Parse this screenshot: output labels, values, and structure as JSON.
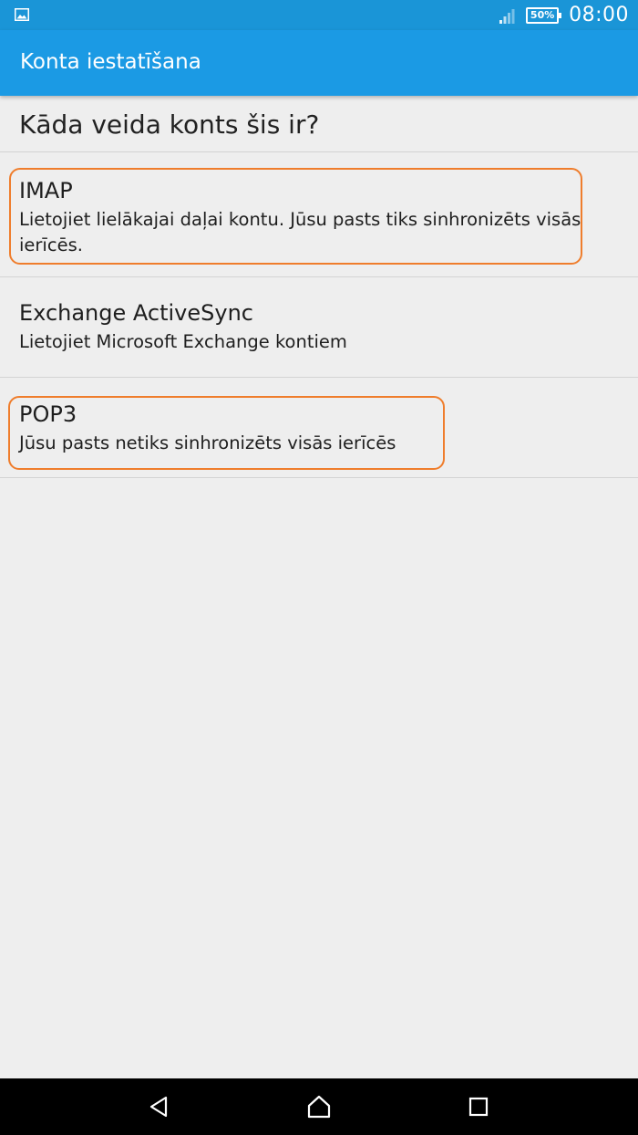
{
  "status_bar": {
    "battery": "50%",
    "time": "08:00",
    "icons": [
      "image-notification-icon",
      "signal-icon",
      "battery-icon"
    ]
  },
  "app_bar": {
    "title": "Konta iestatīšana"
  },
  "question": "Kāda veida konts šis ir?",
  "options": [
    {
      "title": "IMAP",
      "description": "Lietojiet lielākajai daļai kontu. Jūsu pasts tiks sinhronizēts visās ierīcēs."
    },
    {
      "title": "Exchange ActiveSync",
      "description": "Lietojiet Microsoft Exchange kontiem"
    },
    {
      "title": "POP3",
      "description": "Jūsu pasts netiks sinhronizēts visās ierīcēs"
    }
  ],
  "colors": {
    "status_bar": "#1a95d7",
    "app_bar": "#1b9ae4",
    "background": "#eeeeee",
    "highlight": "#ef7d2c",
    "nav_bar": "#000000"
  },
  "nav_bar": {
    "icons": [
      "back-icon",
      "home-icon",
      "recents-icon"
    ]
  }
}
